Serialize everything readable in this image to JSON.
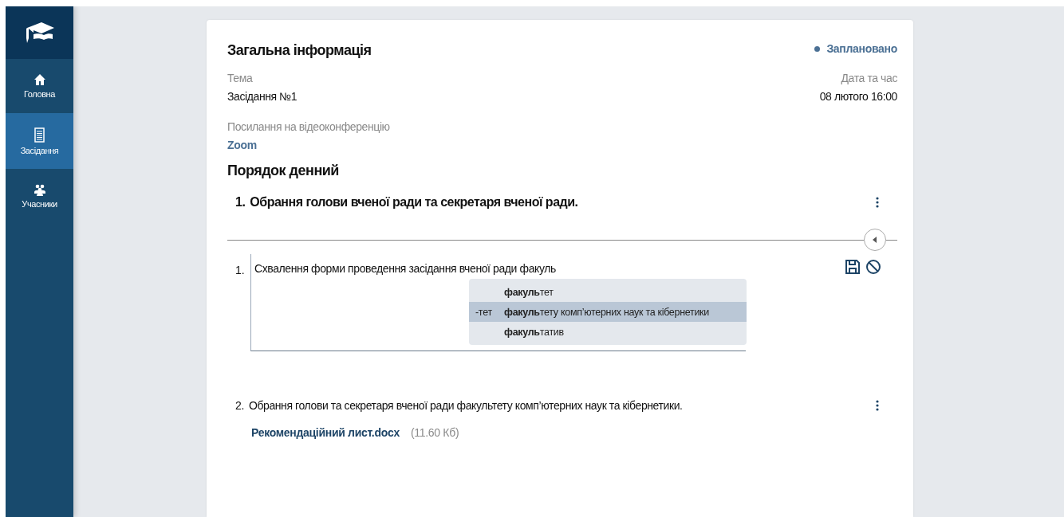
{
  "sidebar": {
    "items": [
      {
        "label": "Головна",
        "kind": "home",
        "selected": false
      },
      {
        "label": "Засідання",
        "kind": "document",
        "selected": true
      },
      {
        "label": "Учасники",
        "kind": "people",
        "selected": false
      }
    ]
  },
  "card": {
    "title": "Загальна інформація",
    "status": "Заплановано",
    "topic_label": "Тема",
    "topic": "Засідання №1",
    "date_label": "Дата та час",
    "date": "08 лютого 16:00",
    "link_label": "Посилання на відеоконференцію",
    "link": "Zoom"
  },
  "agenda": {
    "title": "Порядок денний",
    "item": {
      "number": "1.",
      "title": "Обрання голови вченої ради та секретаря вченої ради."
    },
    "editor": {
      "number": "1.",
      "value": "Схвалення форми проведення засідання вченої ради факуль",
      "suggestions": [
        {
          "text": "**факуль**тет",
          "selected": false
        },
        {
          "prefix": "-тет",
          "text": "**факуль**тету комп’ютерних наук та кібернетики",
          "selected": true
        },
        {
          "text": "**факуль**татив",
          "selected": false
        }
      ]
    },
    "subitems": [
      {
        "number": "2.",
        "text": "Обрання голови та секретаря вченої ради факультету комп’ютерних наук та кібернетики.",
        "file": "Рекомендаційний лист.docx",
        "size": "(11.60 Кб)"
      }
    ]
  }
}
